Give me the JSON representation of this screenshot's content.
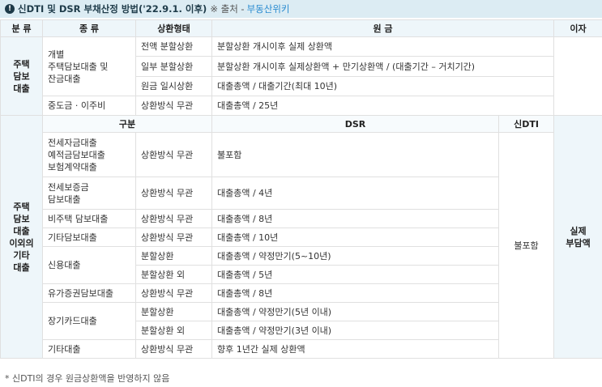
{
  "title": {
    "text": "신DTI 및 DSR 부채산정 방법('22.9.1. 이후)",
    "source_prefix": "※ 출처 -",
    "source_link": "부동산위키"
  },
  "headers": [
    "분 류",
    "종 류",
    "상환형태",
    "원 금",
    "이자"
  ],
  "mortgage": {
    "category": "주택\n담보\n대출",
    "group1_kind": "개별\n주택담보대출 및\n잔금대출",
    "rows": [
      {
        "repay": "전액 분할상환",
        "principal": "분할상환 개시이후 실제 상환액"
      },
      {
        "repay": "일부 분할상환",
        "principal": "분할상환 개시이후 실제상환액 + 만기상환액 / (대출기간 – 거치기간)"
      },
      {
        "repay": "원금 일시상환",
        "principal": "대출총액 / 대출기간(최대 10년)"
      }
    ],
    "midpayment": {
      "kind": "중도금 · 이주비",
      "repay": "상환방식 무관",
      "principal": "대출총액 / 25년"
    }
  },
  "other": {
    "category": "주택\n담보\n대출\n이외의\n기타\n대출",
    "subheader": {
      "gubun": "구분",
      "dsr": "DSR",
      "dti": "신DTI"
    },
    "dti_value": "불포함",
    "interest": "실제\n부담액",
    "rows": [
      {
        "kind": "전세자금대출\n예적금담보대출\n보험계약대출",
        "repay": "상환방식 무관",
        "dsr": "불포함"
      },
      {
        "kind": "전세보증금\n담보대출",
        "repay": "상환방식 무관",
        "dsr": "대출총액 / 4년"
      },
      {
        "kind": "비주택 담보대출",
        "repay": "상환방식 무관",
        "dsr": "대출총액 / 8년"
      },
      {
        "kind": "기타담보대출",
        "repay": "상환방식 무관",
        "dsr": "대출총액 / 10년"
      },
      {
        "kind": "신용대출",
        "repay": "분할상환",
        "dsr": "대출총액 / 약정만기(5~10년)"
      },
      {
        "repay": "분할상환 외",
        "dsr": "대출총액 / 5년"
      },
      {
        "kind": "유가증권담보대출",
        "repay": "상환방식 무관",
        "dsr": "대출총액 / 8년"
      },
      {
        "kind": "장기카드대출",
        "repay": "분할상환",
        "dsr": "대출총액 / 약정만기(5년 이내)"
      },
      {
        "repay": "분할상환 외",
        "dsr": "대출총액 / 약정만기(3년 이내)"
      },
      {
        "kind": "기타대출",
        "repay": "상환방식 무관",
        "dsr": "향후 1년간 실제 상환액"
      }
    ]
  },
  "footnote": "* 신DTI의 경우 원금상환액을 반영하지 않음"
}
